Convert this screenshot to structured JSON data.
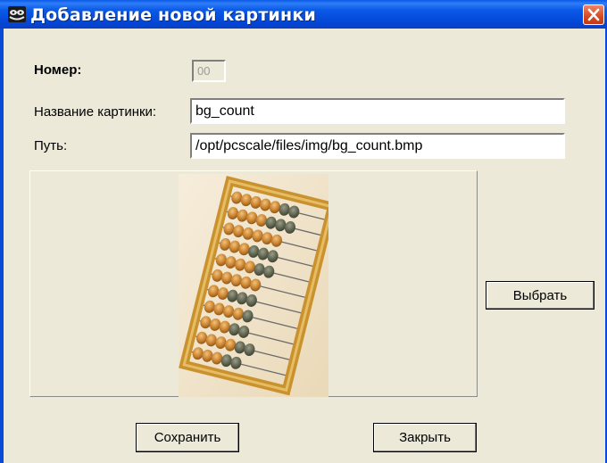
{
  "window": {
    "title": "Добавление новой картинки",
    "icon": "window-app-icon",
    "close_icon": "close-icon"
  },
  "form": {
    "number_label": "Номер:",
    "number_value": "00",
    "name_label": "Название картинки:",
    "name_value": "bg_count",
    "path_label": "Путь:",
    "path_value": "/opt/pcscale/files/img/bg_count.bmp"
  },
  "preview": {
    "image": "abacus-image"
  },
  "buttons": {
    "choose_label": "Выбрать",
    "save_label": "Сохранить",
    "close_label": "Закрыть"
  },
  "colors": {
    "titlebar": "#0a5ae8",
    "face": "#ece9d8",
    "close": "#d74a22"
  }
}
